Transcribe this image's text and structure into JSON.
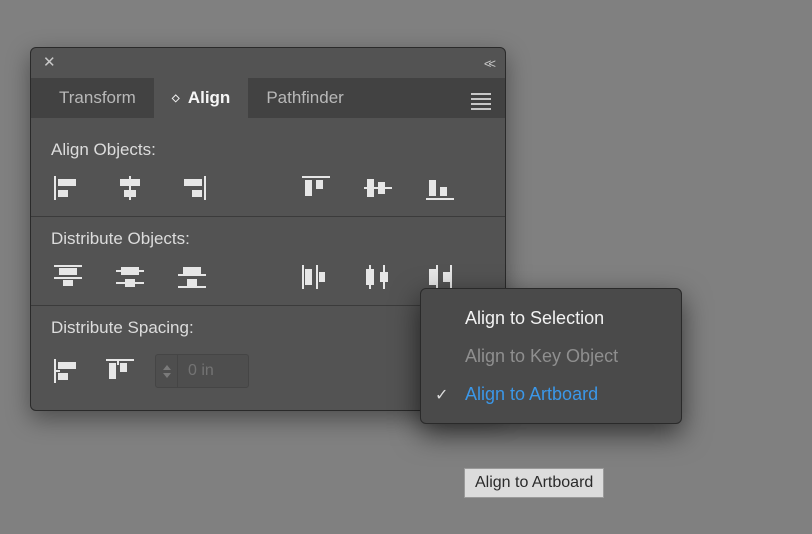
{
  "panel": {
    "tabs": [
      {
        "label": "Transform"
      },
      {
        "label": "Align"
      },
      {
        "label": "Pathfinder"
      }
    ],
    "sections": {
      "align_objects": "Align Objects:",
      "distribute_objects": "Distribute Objects:",
      "distribute_spacing": "Distribute Spacing:"
    },
    "spacing_value": "0 in"
  },
  "align_to_menu": {
    "items": [
      {
        "label": "Align to Selection",
        "enabled": true,
        "selected": false
      },
      {
        "label": "Align to Key Object",
        "enabled": false,
        "selected": false
      },
      {
        "label": "Align to Artboard",
        "enabled": true,
        "selected": true
      }
    ]
  },
  "tooltip": "Align to Artboard"
}
